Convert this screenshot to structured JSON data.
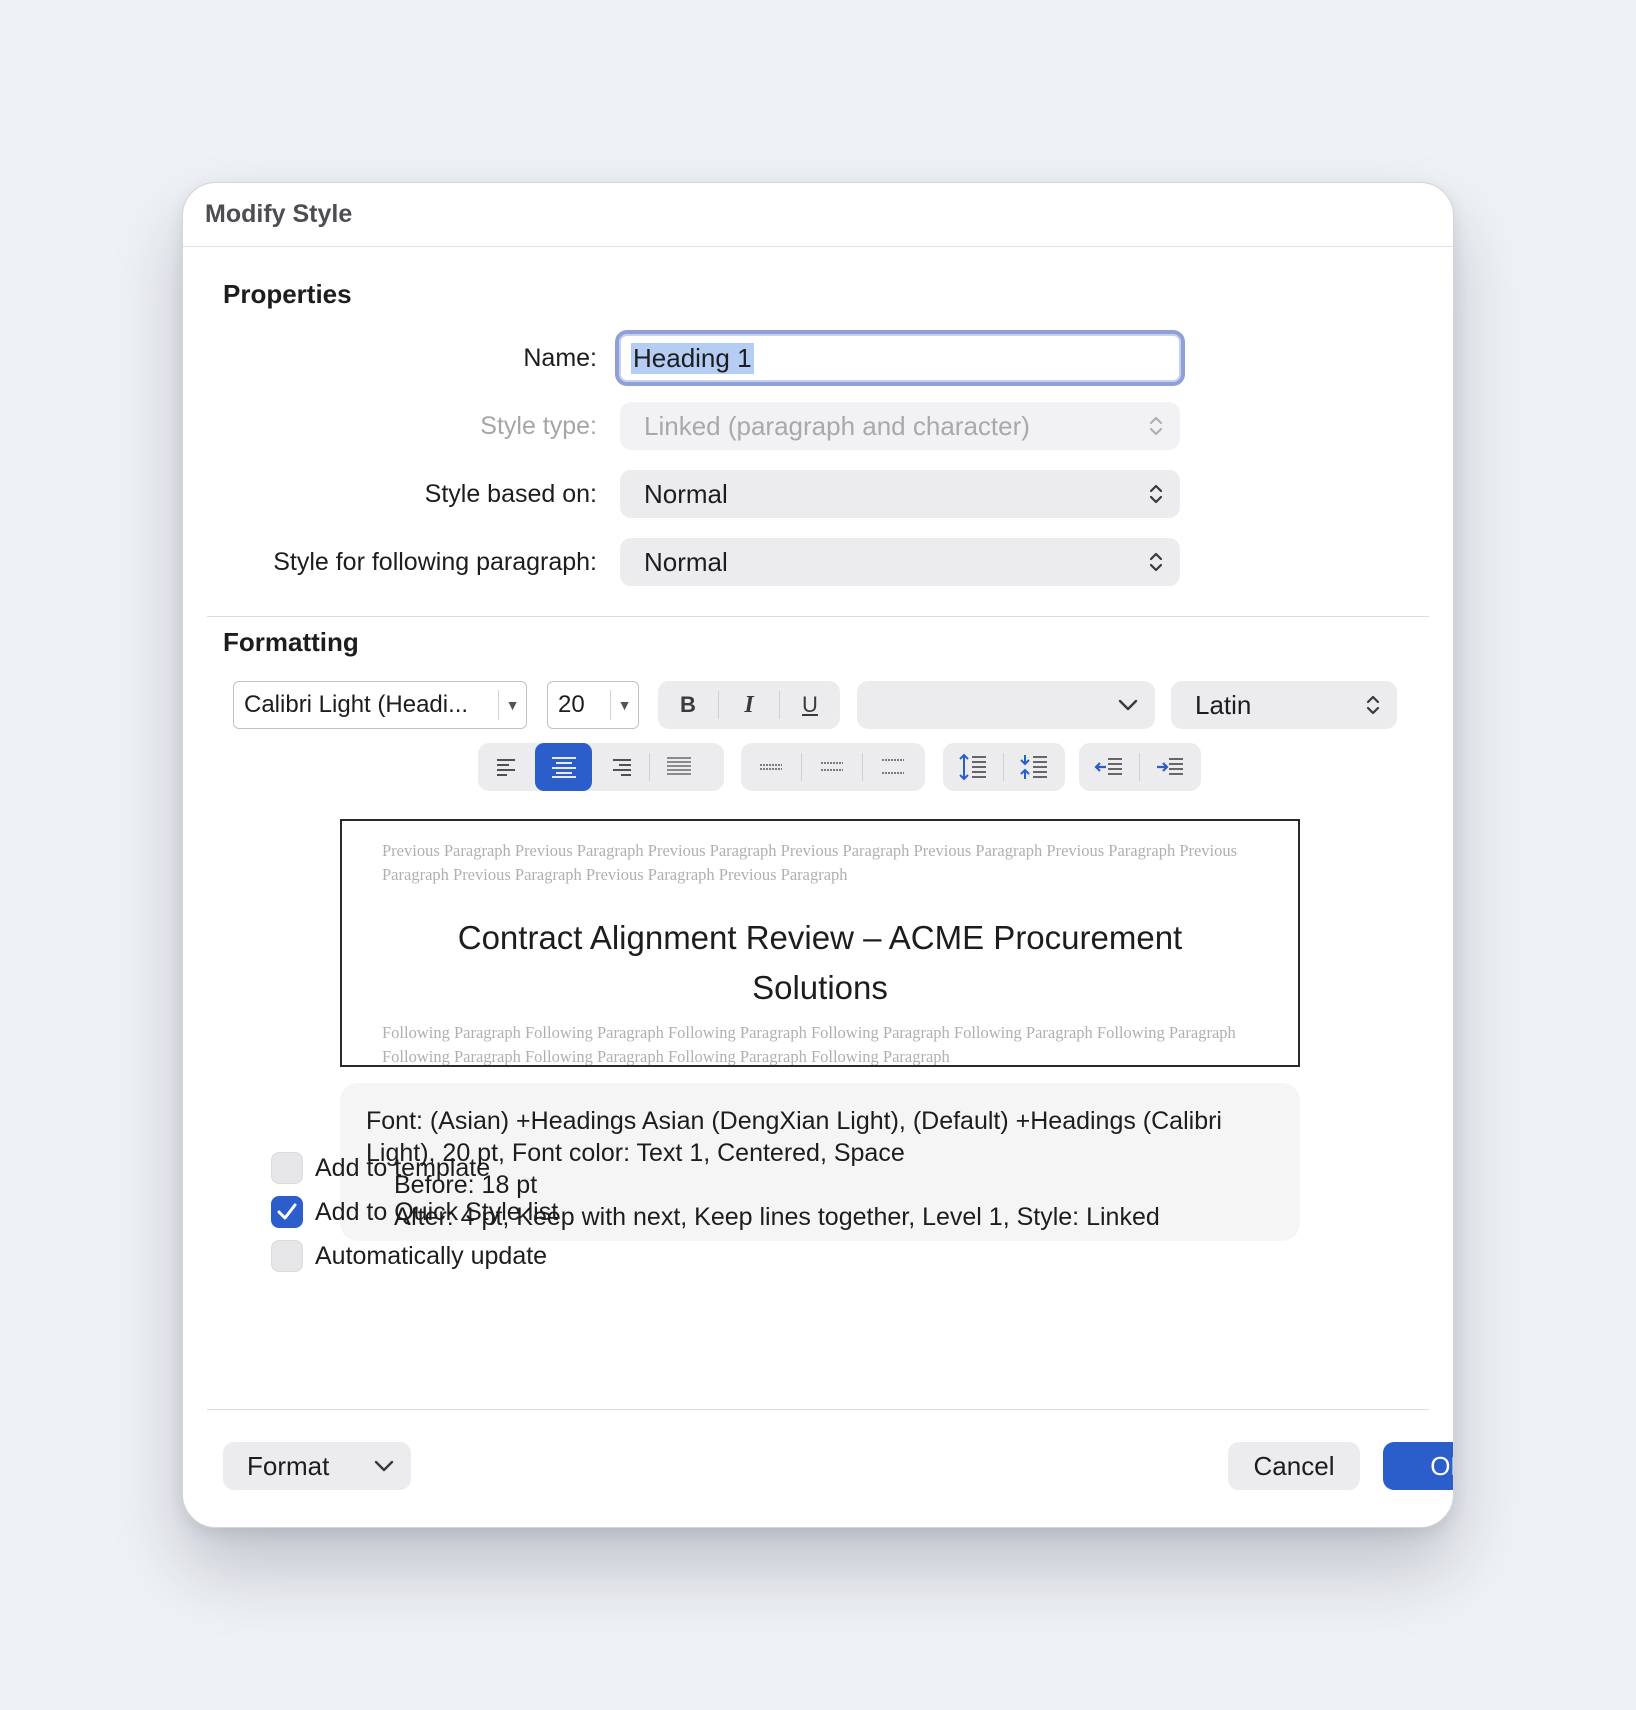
{
  "dialog": {
    "title": "Modify Style"
  },
  "properties": {
    "section_title": "Properties",
    "name_label": "Name:",
    "name_value": "Heading 1",
    "style_type_label": "Style type:",
    "style_type_value": "Linked (paragraph and character)",
    "based_on_label": "Style based on:",
    "based_on_value": "Normal",
    "following_label": "Style for following paragraph:",
    "following_value": "Normal"
  },
  "formatting": {
    "section_title": "Formatting",
    "font_name": "Calibri Light (Headi...",
    "font_size": "20",
    "bold": "B",
    "italic": "I",
    "underline": "U",
    "color_value": "",
    "script_value": "Latin",
    "alignment_selected": "center"
  },
  "preview": {
    "previous_text": "Previous Paragraph Previous Paragraph Previous Paragraph Previous Paragraph Previous Paragraph Previous Paragraph Previous Paragraph Previous Paragraph Previous Paragraph Previous Paragraph",
    "heading_text": "Contract Alignment Review – ACME Procurement Solutions",
    "following_text": "Following Paragraph Following Paragraph Following Paragraph Following Paragraph Following Paragraph Following Paragraph Following Paragraph Following Paragraph Following Paragraph Following Paragraph"
  },
  "description": {
    "line1": "Font: (Asian) +Headings Asian (DengXian Light), (Default) +Headings (Calibri Light), 20 pt, Font color: Text 1, Centered, Space",
    "line2": "Before:  18 pt",
    "line3": "After:  4 pt, Keep with next, Keep lines together, Level 1, Style: Linked"
  },
  "options": {
    "add_to_template": {
      "label": "Add to template",
      "checked": false
    },
    "add_to_quick_style": {
      "label": "Add to Quick Style list",
      "checked": true
    },
    "auto_update": {
      "label": "Automatically update",
      "checked": false
    }
  },
  "footer": {
    "format_label": "Format",
    "cancel_label": "Cancel",
    "ok_label": "OK"
  },
  "colors": {
    "accent": "#2c5ecb",
    "focus_ring": "#8ea0d6"
  }
}
